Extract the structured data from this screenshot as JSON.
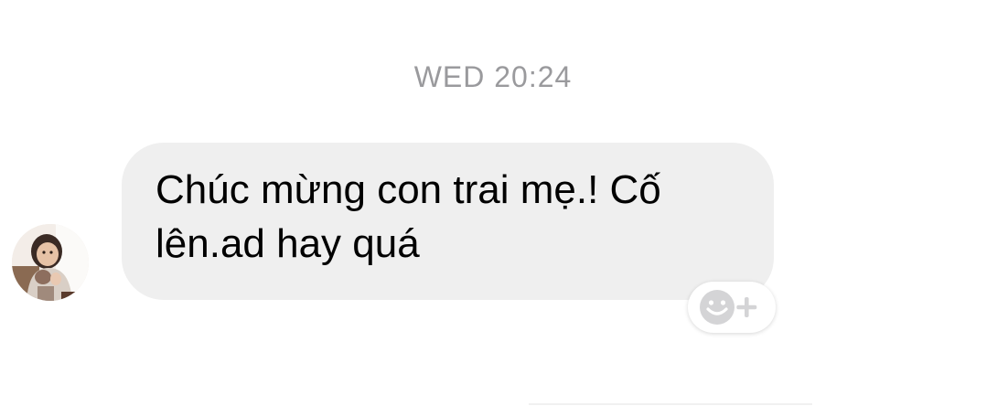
{
  "conversation": {
    "timestamp": "WED 20:24",
    "messages": [
      {
        "direction": "incoming",
        "text": "Chúc mừng con trai mẹ.! Cố\nlên.ad hay quá"
      }
    ]
  },
  "reaction_button": {
    "icon": "smiley-add-icon"
  },
  "colors": {
    "background": "#ffffff",
    "bubble": "#efefef",
    "timestamp": "#9a9a9d",
    "reaction_icon": "#d4d4d6"
  }
}
